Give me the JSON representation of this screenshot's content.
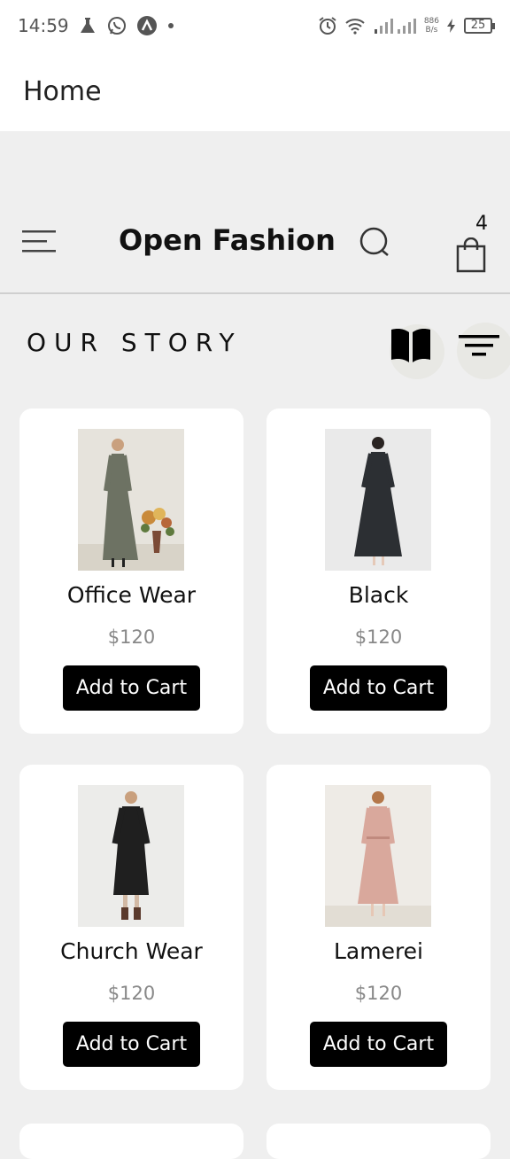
{
  "status_bar": {
    "time": "14:59",
    "net_speed_value": "886",
    "net_speed_unit": "B/s",
    "battery": "25"
  },
  "app_bar": {
    "title": "Home"
  },
  "header": {
    "brand": "Open Fashion",
    "cart_count": "4"
  },
  "section": {
    "title": "OUR STORY"
  },
  "products": [
    {
      "name": "Office Wear",
      "price": "$120",
      "button": "Add to Cart"
    },
    {
      "name": "Black",
      "price": "$120",
      "button": "Add to Cart"
    },
    {
      "name": "Church Wear",
      "price": "$120",
      "button": "Add to Cart"
    },
    {
      "name": "Lamerei",
      "price": "$120",
      "button": "Add to Cart"
    }
  ]
}
